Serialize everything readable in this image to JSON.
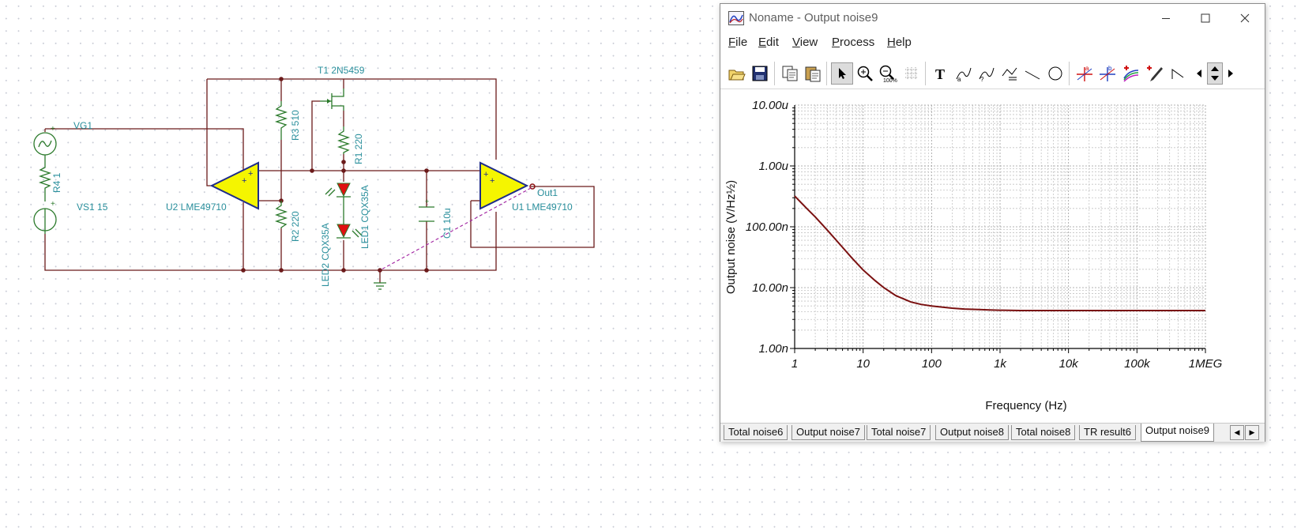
{
  "schematic": {
    "labels": {
      "vg1": "VG1",
      "r4": "R4 1",
      "vs1": "VS1 15",
      "u2": "U2 LME49710",
      "r3": "R3 510",
      "r2": "R2 220",
      "t1": "T1 2N5459",
      "r1": "R1 220",
      "led2": "LED2 CQX35A",
      "led1": "LED1 CQX35A",
      "c1": "C1 10u",
      "u1": "U1 LME49710",
      "out1": "Out1"
    },
    "colors": {
      "wire": "#6b1a1a",
      "component": "#2b7a2b",
      "label": "#2a8f9c",
      "opamp_fill": "#f5f500",
      "led_fill": "#e01010"
    }
  },
  "window": {
    "title": "Noname - Output noise9",
    "menu": {
      "file": {
        "u": "F",
        "rest": "ile"
      },
      "edit": {
        "u": "E",
        "rest": "dit"
      },
      "view": {
        "u": "V",
        "rest": "iew"
      },
      "process": {
        "u": "P",
        "rest": "rocess"
      },
      "help": {
        "u": "H",
        "rest": "elp"
      }
    },
    "toolbar_icons": [
      "open-icon",
      "save-icon",
      "copy-icon",
      "paste-icon",
      "pointer-icon",
      "zoom-in-icon",
      "zoom-100-icon",
      "grid-icon",
      "text-icon",
      "cursor-a-icon",
      "cursor-b-icon",
      "fit-icon",
      "line-icon",
      "ellipse-icon",
      "cursor-a-red-icon",
      "cursor-b-blue-icon",
      "curve-icon",
      "pen-icon",
      "marker-icon",
      "scroll-left-icon",
      "scroll-up-down-icon",
      "scroll-right-icon"
    ],
    "tabs": [
      "Total noise6",
      "Output noise7",
      "Total noise7",
      "Output noise8",
      "Total noise8",
      "TR result6",
      "Output noise9"
    ],
    "active_tab": "Output noise9"
  },
  "chart_data": {
    "type": "line",
    "title": "",
    "xlabel": "Frequency (Hz)",
    "ylabel": "Output noise (V/Hz½)",
    "x_scale": "log",
    "y_scale": "log",
    "xlim": [
      1,
      1000000
    ],
    "ylim": [
      1e-09,
      1e-05
    ],
    "x_ticks": [
      "1",
      "10",
      "100",
      "1k",
      "10k",
      "100k",
      "1MEG"
    ],
    "y_ticks": [
      "10.00u",
      "1.00u",
      "100.00n",
      "10.00n",
      "1.00n"
    ],
    "grid": true,
    "legend": "none",
    "series_color": "#7a1010",
    "series": [
      {
        "x": [
          1,
          1.5,
          2,
          3,
          5,
          7,
          10,
          15,
          20,
          30,
          50,
          70,
          100,
          150,
          200,
          300,
          500,
          700,
          1000,
          2000,
          5000,
          10000,
          100000,
          1000000
        ],
        "y": [
          3.2e-07,
          2e-07,
          1.45e-07,
          8.8e-08,
          4.6e-08,
          3e-08,
          1.95e-08,
          1.3e-08,
          1e-08,
          7.4e-09,
          5.8e-09,
          5.3e-09,
          5e-09,
          4.75e-09,
          4.6e-09,
          4.45e-09,
          4.35e-09,
          4.3e-09,
          4.25e-09,
          4.2e-09,
          4.2e-09,
          4.2e-09,
          4.2e-09,
          4.2e-09
        ]
      }
    ]
  }
}
